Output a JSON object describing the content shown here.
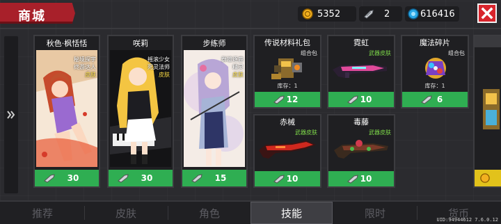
{
  "header": {
    "title": "商城",
    "coins": "5352",
    "fish": "2",
    "gems": "616416"
  },
  "characters": [
    {
      "name": "秋色·枫恬恬",
      "tags": [
        "秘境探宇",
        "终游达人",
        "皮肤"
      ],
      "price": "30"
    },
    {
      "name": "咲莉",
      "tags": [
        "摇滚少女",
        "死灵法师",
        "皮肤"
      ],
      "price": "30"
    },
    {
      "name": "步练师",
      "tags": [
        "群雄逐鹿",
        "精灵",
        "皮肤"
      ],
      "price": "15"
    }
  ],
  "items": [
    {
      "name": "传说材料礼包",
      "tag": "组合包",
      "stock": "库存：1",
      "price": "12"
    },
    {
      "name": "霓虹",
      "tag": "武器皮肤",
      "stock": "",
      "price": "10"
    },
    {
      "name": "魔法碎片",
      "tag": "组合包",
      "stock": "库存：1",
      "price": "6"
    },
    {
      "name": "赤械",
      "tag": "武器皮肤",
      "stock": "",
      "price": "10"
    },
    {
      "name": "毒藤",
      "tag": "武器皮肤",
      "stock": "",
      "price": "10"
    }
  ],
  "tabs": [
    "推荐",
    "皮肤",
    "角色",
    "技能",
    "限时",
    "货币"
  ],
  "active_tab": "技能",
  "uid": "UID:94944612 7.6.0.12",
  "colors": {
    "accent_red": "#a8202a",
    "price_green": "#2fae52",
    "price_gold": "#e2c21b",
    "weapon_tag": "#7fdc4a"
  },
  "icons": {
    "coin": "coin-icon",
    "fish": "fish-icon",
    "gem": "gem-icon",
    "close": "close-icon",
    "expand": "double-chevron-icon"
  }
}
